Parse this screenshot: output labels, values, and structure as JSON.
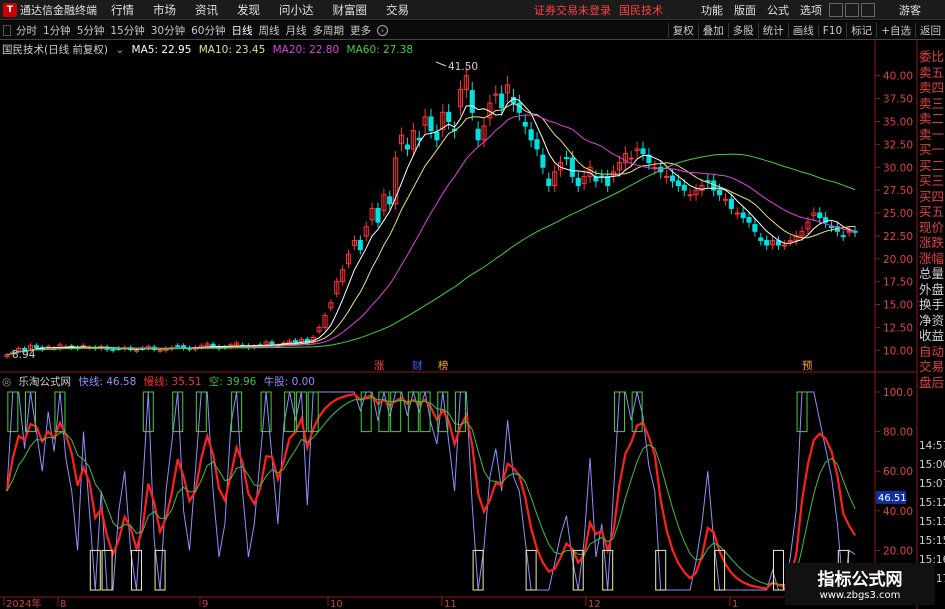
{
  "menubar": {
    "app_title": "通达信金融终端",
    "items": [
      "行情",
      "市场",
      "资讯",
      "发现",
      "问小达",
      "财富圈",
      "交易"
    ],
    "warning": "证券交易未登录",
    "stock_name": "国民技术",
    "right_items": [
      "功能",
      "版面",
      "公式",
      "选项"
    ],
    "guest": "游客"
  },
  "toolbar": {
    "periods": [
      "分时",
      "1分钟",
      "5分钟",
      "15分钟",
      "30分钟",
      "60分钟",
      "日线",
      "周线",
      "月线",
      "多周期",
      "更多"
    ],
    "active_period": "日线",
    "right_buttons": [
      "复权",
      "叠加",
      "多股",
      "统计",
      "画线",
      "F10",
      "标记",
      "+自选",
      "返回"
    ]
  },
  "main_legend": {
    "title": "国民技术(日线 前复权)",
    "ma5": "MA5: 22.95",
    "ma10": "MA10: 23.45",
    "ma20": "MA20: 22.80",
    "ma60": "MA60: 27.38"
  },
  "sub_legend": {
    "title": "乐淘公式网",
    "fast": "快线: 46.58",
    "slow": "慢线: 35.51",
    "empty": "空: 39.96",
    "bull": "牛股: 0.00"
  },
  "colors": {
    "up": "#ff3232",
    "down": "#00e0e0",
    "ma5": "#ffffff",
    "ma10": "#e8e07a",
    "ma20": "#e040e0",
    "ma60": "#40d040",
    "fast": "#9090ff",
    "slow": "#ff2020",
    "empty": "#40c040",
    "yellow_box": "#f0f0a0",
    "green_box": "#40d040"
  },
  "price_axis_labels": [
    "40.00",
    "37.50",
    "35.00",
    "32.50",
    "30.00",
    "27.50",
    "25.00",
    "22.50",
    "20.00",
    "17.50",
    "15.00",
    "12.50",
    "10.00"
  ],
  "indicator_axis_labels": [
    "100.0",
    "80.00",
    "60.00",
    "40.00",
    "20.00"
  ],
  "current_indicator_value": "46.51",
  "price_high_mark": "41.50",
  "price_low_mark": "8.94",
  "event_marks": [
    {
      "label": "涨",
      "color": "#ff4040"
    },
    {
      "label": "财",
      "color": "#4060ff"
    },
    {
      "label": "榜",
      "color": "#ffaa00"
    },
    {
      "label": "预",
      "color": "#ffaa00"
    }
  ],
  "x_axis_labels": [
    "2024年",
    "8",
    "9",
    "10",
    "11",
    "12",
    "1"
  ],
  "right_panel": {
    "quote_labels": [
      "委比",
      "卖五",
      "卖四",
      "卖三",
      "卖二",
      "卖一",
      "买一",
      "买二",
      "买三",
      "买四",
      "买五",
      "现价",
      "涨跌",
      "涨幅",
      "总量",
      "外盘",
      "换手",
      "净资",
      "收益",
      "自动",
      "交易",
      "盘后"
    ],
    "times": [
      "14:57",
      "15:00",
      "15:07",
      "15:12",
      "15:13",
      "15:15",
      "15:16",
      "15:17"
    ]
  },
  "watermark": {
    "line1": "指标公式网",
    "line2": "www.zbgs3.com"
  },
  "chart_data": {
    "type": "candlestick",
    "closes": [
      9.5,
      9.8,
      10.2,
      10.0,
      10.5,
      10.3,
      10.1,
      10.4,
      10.2,
      10.6,
      10.4,
      10.3,
      10.2,
      10.5,
      10.3,
      10.2,
      10.4,
      10.1,
      10.0,
      10.2,
      10.3,
      10.1,
      10.0,
      10.2,
      10.4,
      10.1,
      10.0,
      10.2,
      10.3,
      10.5,
      10.2,
      10.1,
      10.3,
      10.5,
      10.7,
      10.4,
      10.2,
      10.3,
      10.6,
      10.8,
      10.5,
      10.3,
      10.4,
      10.6,
      10.9,
      10.7,
      10.5,
      10.8,
      11.0,
      10.9,
      11.2,
      10.8,
      11.4,
      12.5,
      13.8,
      15.2,
      17.5,
      18.8,
      20.5,
      22.0,
      21.0,
      23.5,
      25.5,
      24.0,
      27.0,
      26.0,
      31.0,
      33.5,
      32.0,
      34.0,
      33.0,
      35.5,
      34.0,
      33.0,
      36.0,
      35.0,
      34.0,
      38.5,
      40.0,
      36.0,
      33.0,
      34.5,
      37.0,
      38.0,
      36.5,
      39.0,
      37.0,
      36.0,
      34.5,
      33.0,
      32.0,
      30.0,
      28.0,
      29.5,
      30.5,
      31.0,
      29.0,
      28.0,
      29.0,
      30.0,
      28.5,
      29.0,
      28.0,
      29.5,
      30.5,
      31.5,
      31.0,
      32.0,
      31.5,
      30.5,
      30.0,
      29.5,
      29.0,
      28.5,
      28.0,
      27.5,
      27.0,
      27.5,
      28.0,
      28.5,
      27.5,
      27.0,
      26.5,
      25.5,
      25.0,
      24.5,
      24.0,
      23.0,
      22.0,
      21.5,
      22.0,
      21.5,
      21.5,
      22.0,
      22.5,
      23.0,
      24.0,
      25.0,
      24.5,
      24.0,
      23.5,
      23.0,
      22.5,
      23.0,
      22.95
    ],
    "ma60_end": 27.38,
    "ylim": [
      8.94,
      41.5
    ],
    "indicator": {
      "fast_end": 46.58,
      "slow_end": 35.51,
      "empty_end": 39.96,
      "ylim": [
        0,
        100
      ]
    }
  }
}
